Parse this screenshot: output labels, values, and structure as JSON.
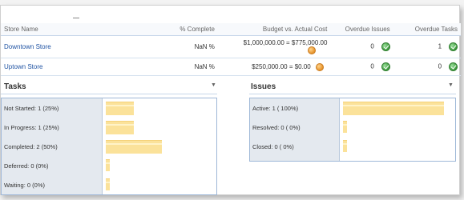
{
  "table": {
    "headers": {
      "store_name": "Store Name",
      "pct_complete": "% Complete",
      "budget": "Budget vs. Actual Cost",
      "overdue_issues": "Overdue Issues",
      "overdue_tasks": "Overdue Tasks"
    },
    "rows": [
      {
        "name": "Downtown Store",
        "pct": "NaN %",
        "budget": "$1,000,000.00 = $775,000.00",
        "budget_status": "orange-dot-icon",
        "overdue_issues": "0",
        "issues_status": "green-check-icon",
        "overdue_tasks": "1",
        "tasks_status": "green-check-icon"
      },
      {
        "name": "Uptown Store",
        "pct": "NaN %",
        "budget": "$250,000.00 = $0.00",
        "budget_status": "orange-dot-icon",
        "overdue_issues": "0",
        "issues_status": "green-check-icon",
        "overdue_tasks": "0",
        "tasks_status": "green-check-icon"
      }
    ]
  },
  "tasks": {
    "title": "Tasks",
    "rows": [
      {
        "label": "Not Started: 1 (25%)",
        "value": 25
      },
      {
        "label": "In Progress: 1 (25%)",
        "value": 25
      },
      {
        "label": "Completed: 2 (50%)",
        "value": 50
      },
      {
        "label": "Deferred: 0 (0%)",
        "value": 0
      },
      {
        "label": "Waiting: 0 (0%)",
        "value": 0
      }
    ]
  },
  "issues": {
    "title": "Issues",
    "rows": [
      {
        "label": "Active: 1 ( 100%)",
        "value": 100
      },
      {
        "label": "Resolved: 0 ( 0%)",
        "value": 0
      },
      {
        "label": "Closed: 0 ( 0%)",
        "value": 0
      }
    ]
  },
  "colors": {
    "bar": "#fbe29a",
    "link": "#2255a4",
    "ok": "#3c9a3c",
    "warn": "#e5922b"
  }
}
